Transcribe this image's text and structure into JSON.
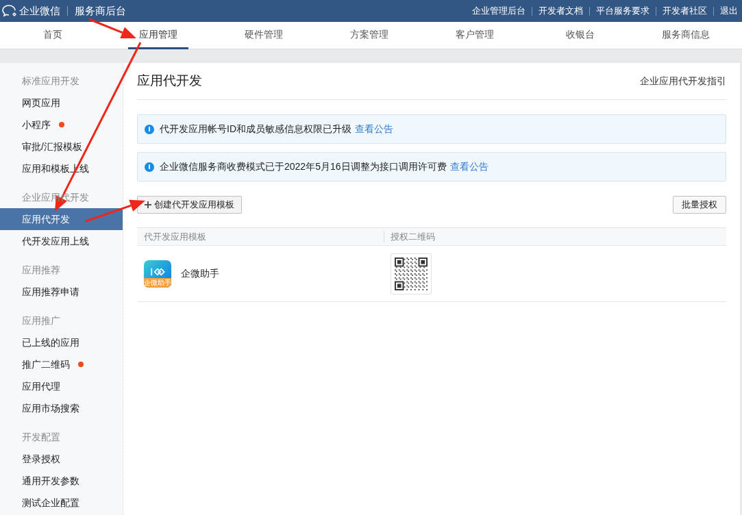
{
  "topbar": {
    "brand": "企业微信",
    "product": "服务商后台",
    "links": [
      "企业管理后台",
      "开发者文档",
      "平台服务要求",
      "开发者社区",
      "退出"
    ]
  },
  "nav_tabs": [
    {
      "label": "首页",
      "selected": false
    },
    {
      "label": "应用管理",
      "selected": true
    },
    {
      "label": "硬件管理",
      "selected": false
    },
    {
      "label": "方案管理",
      "selected": false
    },
    {
      "label": "客户管理",
      "selected": false
    },
    {
      "label": "收银台",
      "selected": false
    },
    {
      "label": "服务商信息",
      "selected": false
    }
  ],
  "sidebar": {
    "sections": [
      {
        "title": "标准应用开发",
        "items": [
          {
            "label": "网页应用",
            "selected": false,
            "dot": false
          },
          {
            "label": "小程序",
            "selected": false,
            "dot": true
          },
          {
            "label": "审批/汇报模板",
            "selected": false,
            "dot": false
          },
          {
            "label": "应用和模板上线",
            "selected": false,
            "dot": false
          }
        ]
      },
      {
        "title": "企业应用代开发",
        "items": [
          {
            "label": "应用代开发",
            "selected": true,
            "dot": false
          },
          {
            "label": "代开发应用上线",
            "selected": false,
            "dot": false
          }
        ]
      },
      {
        "title": "应用推荐",
        "items": [
          {
            "label": "应用推荐申请",
            "selected": false,
            "dot": false
          }
        ]
      },
      {
        "title": "应用推广",
        "items": [
          {
            "label": "已上线的应用",
            "selected": false,
            "dot": false
          },
          {
            "label": "推广二维码",
            "selected": false,
            "dot": true
          },
          {
            "label": "应用代理",
            "selected": false,
            "dot": false
          },
          {
            "label": "应用市场搜索",
            "selected": false,
            "dot": false
          }
        ]
      },
      {
        "title": "开发配置",
        "items": [
          {
            "label": "登录授权",
            "selected": false,
            "dot": false
          },
          {
            "label": "通用开发参数",
            "selected": false,
            "dot": false
          },
          {
            "label": "测试企业配置",
            "selected": false,
            "dot": false
          }
        ]
      }
    ]
  },
  "main": {
    "title": "应用代开发",
    "guide_link": "企业应用代开发指引",
    "notices": [
      {
        "text": "代开发应用帐号ID和成员敏感信息权限已升级",
        "link": "查看公告"
      },
      {
        "text": "企业微信服务商收费模式已于2022年5月16日调整为接口调用许可费",
        "link": "查看公告"
      }
    ],
    "create_button": "创建代开发应用模板",
    "batch_button": "批量授权",
    "table": {
      "columns": [
        "代开发应用模板",
        "授权二维码"
      ],
      "rows": [
        {
          "name": "企微助手",
          "icon_label": "企微助手"
        }
      ]
    }
  }
}
